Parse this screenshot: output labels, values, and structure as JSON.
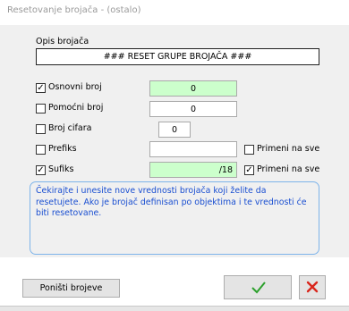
{
  "window": {
    "title": "Resetovanje brojača - (ostalo)"
  },
  "opis": {
    "label": "Opis brojača",
    "value": "### RESET GRUPE BROJAČA ###"
  },
  "rows": [
    {
      "label": "Osnovni broj",
      "checked": true,
      "value": "0"
    },
    {
      "label": "Pomoćni broj",
      "checked": false,
      "value": "0"
    },
    {
      "label": "Broj cifara",
      "checked": false,
      "value": "0"
    },
    {
      "label": "Prefiks",
      "checked": false,
      "value": "",
      "apply_label": "Primeni na sve",
      "apply_checked": false
    },
    {
      "label": "Sufiks",
      "checked": true,
      "value": "/18",
      "apply_label": "Primeni na sve",
      "apply_checked": true
    }
  ],
  "info_text": "Čekirajte i unesite nove vrednosti brojača koji želite da resetujete. Ako je brojač definisan po objektima i te vrednosti će biti resetovane.",
  "buttons": {
    "reset_numbers": "Poništi brojeve",
    "ok_icon": "check-icon",
    "cancel_icon": "close-icon"
  },
  "colors": {
    "highlight_field": "#ccffcc",
    "info_text": "#1a4fd1",
    "ok_green": "#2ca02c",
    "cancel_red": "#d9261c"
  }
}
